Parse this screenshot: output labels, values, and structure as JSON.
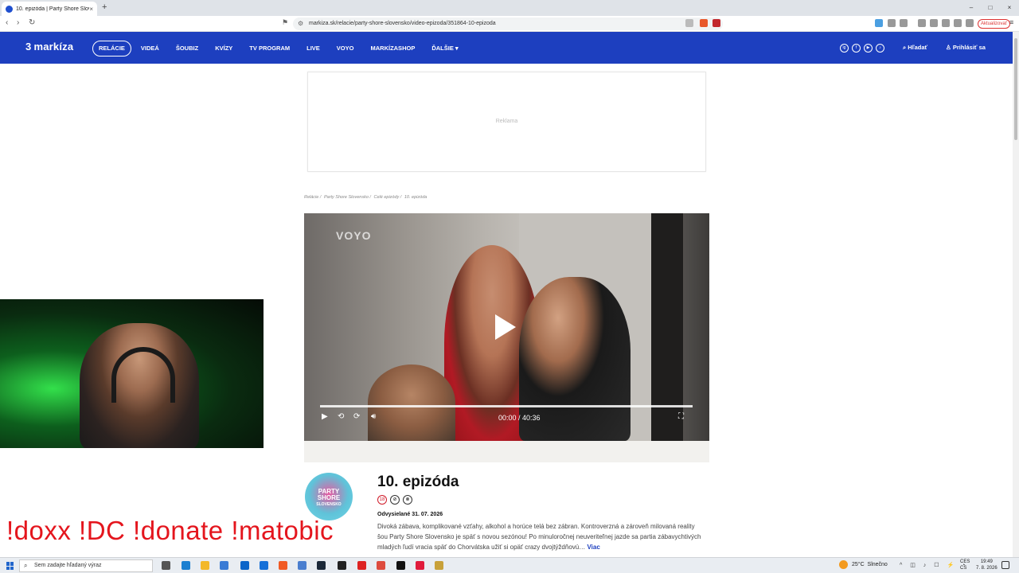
{
  "browser": {
    "tab_title": "10. epizóda | Party Shore Sloven",
    "tab_close": "×",
    "new_tab": "+",
    "url": "markiza.sk/relacie/party-shore-slovensko/video-epizoda/351864-10-epizoda",
    "update_button": "Aktualizovať",
    "win_min": "–",
    "win_max": "□",
    "win_close": "×"
  },
  "site": {
    "logo": "markíza",
    "logo_mark": "3",
    "nav": [
      "RELÁCIE",
      "VIDEÁ",
      "ŠOUBIZ",
      "KVÍZY",
      "TV PROGRAM",
      "LIVE",
      "VOYO",
      "MARKÍZASHOP",
      "ĎALŠIE ▾"
    ],
    "social": [
      "ig",
      "f",
      "▶",
      "♪"
    ],
    "search_label": "Hľadať",
    "login_label": "Prihlásiť sa"
  },
  "ad": {
    "label": "Reklama"
  },
  "breadcrumb": [
    "Relácie /",
    "Party Shore Slovensko /",
    "Celé epizódy /",
    "10. epizóda"
  ],
  "player": {
    "brand": "VOYO",
    "time": "00:00 / 40:36"
  },
  "episode": {
    "show_logo_line1": "PARTY",
    "show_logo_line2": "SHORE",
    "show_logo_line3": "SLOVENSKO",
    "title": "10. epizóda",
    "badges": [
      "18",
      "⊘",
      "⊗"
    ],
    "aired": "Odvysielané 31. 07. 2026",
    "description": "Divoká zábava, komplikované vzťahy, alkohol a horúce telá bez zábran. Kontroverzná a zároveň milovaná reality šou Party Shore Slovensko je späť s novou sezónou! Po minuloročnej neuveriteľnej jazde sa partia zábavychtivých mladých ľudí vracia späť do Chorvátska užiť si opäť crazy dvojtýždňovú…",
    "more": "Viac"
  },
  "overlay": {
    "commands": "!doxx  !DC !donate !matobic"
  },
  "taskbar": {
    "search_placeholder": "Sem zadajte hľadaný výraz",
    "weather_temp": "25°C",
    "weather_text": "Slnečno",
    "lang1": "CES",
    "lang2": "CS",
    "time": "19:49",
    "date": "7. 8. 2026"
  }
}
